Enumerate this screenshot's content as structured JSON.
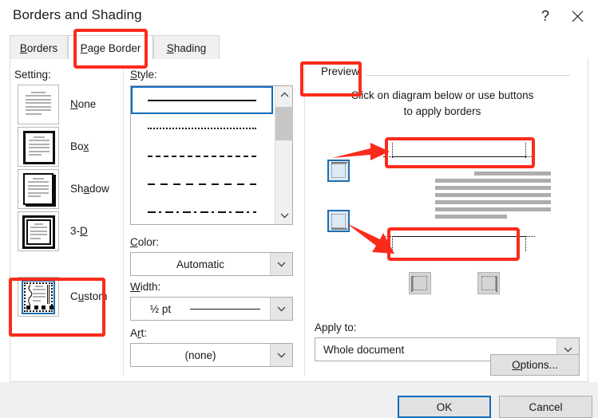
{
  "window": {
    "title": "Borders and Shading",
    "help_icon": "question-mark-icon",
    "close_icon": "close-icon"
  },
  "tabs": [
    {
      "id": "borders",
      "label": "Borders",
      "accel": "B",
      "active": false
    },
    {
      "id": "page_border",
      "label": "Page Border",
      "accel": "P",
      "active": true,
      "highlighted": true
    },
    {
      "id": "shading",
      "label": "Shading",
      "accel": "S",
      "active": false
    }
  ],
  "setting": {
    "label": "Setting:",
    "options": [
      {
        "id": "none",
        "label": "None",
        "accel": "N",
        "selected": false,
        "highlighted": false
      },
      {
        "id": "box",
        "label": "Box",
        "accel": "x",
        "selected": false,
        "highlighted": false
      },
      {
        "id": "shadow",
        "label": "Shadow",
        "accel": "a",
        "selected": false,
        "highlighted": false
      },
      {
        "id": "3d",
        "label": "3-D",
        "accel": "D",
        "selected": false,
        "highlighted": false
      },
      {
        "id": "custom",
        "label": "Custom",
        "accel": "u",
        "selected": true,
        "highlighted": true
      }
    ]
  },
  "style": {
    "label": "Style:",
    "selected_index": 0,
    "items": [
      {
        "name": "solid",
        "css": "solid"
      },
      {
        "name": "dotted",
        "css": "dotted"
      },
      {
        "name": "dashed-small",
        "css": "dashed-small"
      },
      {
        "name": "dashed-large",
        "css": "dashed-large"
      },
      {
        "name": "dash-dot",
        "css": "dash-dot"
      }
    ],
    "scrollbar": {
      "up_icon": "chevron-up-icon",
      "down_icon": "chevron-down-icon"
    }
  },
  "color": {
    "label": "Color:",
    "accel": "C",
    "value": "Automatic",
    "arrow_icon": "chevron-down-icon"
  },
  "width": {
    "label": "Width:",
    "accel": "W",
    "value": "½ pt",
    "arrow_icon": "chevron-down-icon"
  },
  "art": {
    "label": "Art:",
    "accel": "r",
    "value": "(none)",
    "arrow_icon": "chevron-down-icon"
  },
  "preview": {
    "legend": "Preview",
    "legend_highlighted": true,
    "hint_line1": "Click on diagram below or use buttons",
    "hint_line2": "to apply borders",
    "text_lines": 7,
    "buttons": [
      {
        "id": "top",
        "name": "apply-top-border-button",
        "state": "active",
        "edge": "top"
      },
      {
        "id": "bottom",
        "name": "apply-bottom-border-button",
        "state": "active",
        "edge": "bottom"
      },
      {
        "id": "left",
        "name": "apply-left-border-button",
        "state": "normal",
        "edge": "left"
      },
      {
        "id": "right",
        "name": "apply-right-border-button",
        "state": "normal",
        "edge": "right"
      }
    ],
    "highlighted_regions": [
      "top-border-preview",
      "bottom-border-preview"
    ]
  },
  "apply_to": {
    "label": "Apply to:",
    "value": "Whole document",
    "arrow_icon": "chevron-down-icon"
  },
  "options_button": {
    "label": "Options...",
    "accel": "O"
  },
  "footer": {
    "ok_label": "OK",
    "cancel_label": "Cancel",
    "default_button": "OK"
  },
  "colors": {
    "annotation_red": "#fb2b1c",
    "accent_blue": "#0f6cbd",
    "button_face": "#e1e1e1",
    "dialog_bg": "#ffffff",
    "footer_bg": "#f0f0f0",
    "preview_text_gray": "#adadad"
  }
}
